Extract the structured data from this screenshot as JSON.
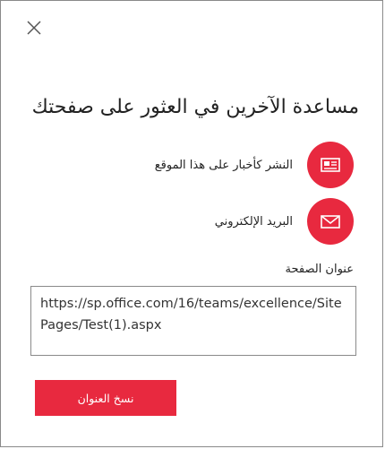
{
  "dialog": {
    "title": "مساعدة الآخرين في العثور على صفحتك",
    "close_icon": "close-icon"
  },
  "options": {
    "news": {
      "label": "النشر كأخبار على هذا الموقع",
      "icon": "newspaper-icon"
    },
    "email": {
      "label": "البريد الإلكتروني",
      "icon": "envelope-icon"
    }
  },
  "address": {
    "label": "عنوان الصفحة",
    "value": "https://sp.office.com/16/teams/excellence/SitePages/Test(1).aspx"
  },
  "copy_button": {
    "label": "نسخ العنوان"
  },
  "colors": {
    "accent": "#e8293f",
    "border": "#8a8a8a"
  }
}
